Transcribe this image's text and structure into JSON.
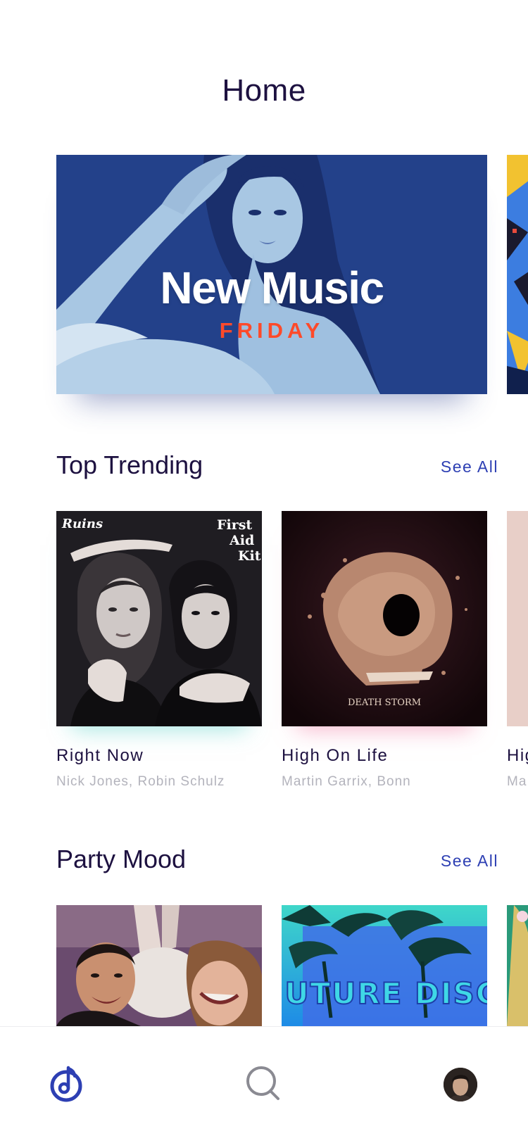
{
  "header": {
    "title": "Home"
  },
  "hero": {
    "title": "New Music",
    "subtitle": "FRIDAY"
  },
  "sections": {
    "top_trending": {
      "title": "Top Trending",
      "see_all": "See All",
      "items": [
        {
          "title": "Right Now",
          "artist": "Nick Jones, Robin Schulz",
          "art_text_1": "Ruins",
          "art_text_2": "First Aid Kit"
        },
        {
          "title": "High On Life",
          "artist": "Martin Garrix, Bonn",
          "art_text": "DEATH STORM"
        },
        {
          "title": "Hig",
          "artist": "Ma"
        }
      ]
    },
    "party_mood": {
      "title": "Party Mood",
      "see_all": "See All",
      "items": [
        {
          "art": "party-crowd"
        },
        {
          "art_text": "FUTURE DISCO"
        },
        {
          "art": "partial"
        }
      ]
    }
  },
  "tabbar": {
    "items": [
      {
        "name": "home",
        "icon": "music-note-icon",
        "active": true
      },
      {
        "name": "search",
        "icon": "search-icon",
        "active": false
      },
      {
        "name": "profile",
        "icon": "avatar",
        "active": false
      }
    ]
  },
  "colors": {
    "primary_text": "#1d1140",
    "accent": "#2d3fb3",
    "muted_text": "#b3b3bc",
    "hero_bg": "#23418a",
    "hero_accent": "#ff4a2a"
  }
}
